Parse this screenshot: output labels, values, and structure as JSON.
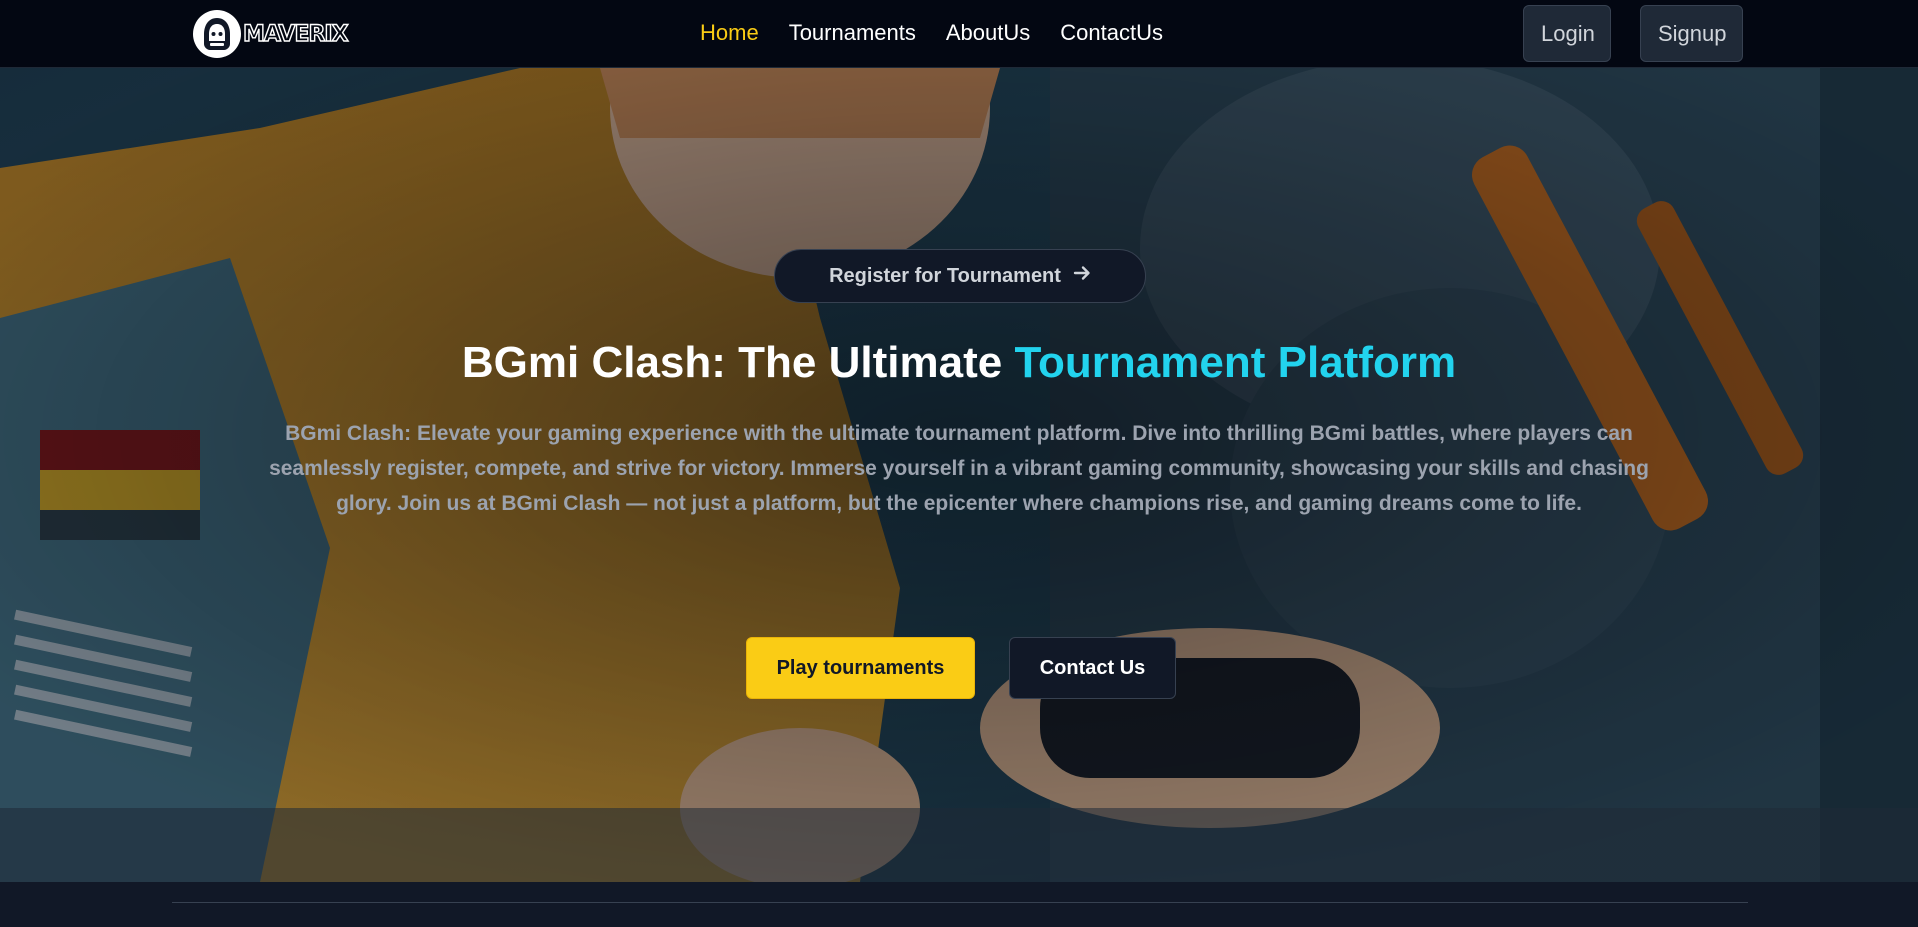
{
  "brand": {
    "name": "MAVERIX",
    "logo_icon": "hooded-gamer-icon"
  },
  "nav": {
    "links": [
      {
        "label": "Home",
        "active": true
      },
      {
        "label": "Tournaments",
        "active": false
      },
      {
        "label": "AboutUs",
        "active": false
      },
      {
        "label": "ContactUs",
        "active": false
      }
    ],
    "login_label": "Login",
    "signup_label": "Signup"
  },
  "hero": {
    "register_label": "Register for Tournament",
    "register_icon": "arrow-right-icon",
    "title_main": "BGmi Clash: The Ultimate ",
    "title_accent": "Tournament Platform",
    "description": "BGmi Clash: Elevate your gaming experience with the ultimate tournament platform. Dive into thrilling BGmi battles, where players can seamlessly register, compete, and strive for victory. Immerse yourself in a vibrant gaming community, showcasing your skills and chasing glory. Join us at BGmi Clash — not just a platform, but the epicenter where champions rise, and gaming dreams come to life.",
    "play_label": "Play tournaments",
    "contact_label": "Contact Us",
    "background_image": "illustrated-gamer-girl-with-controller-and-robot"
  },
  "colors": {
    "accent_yellow": "#facc15",
    "accent_cyan": "#22d3ee",
    "nav_bg": "#030712",
    "page_bg": "#111827"
  }
}
